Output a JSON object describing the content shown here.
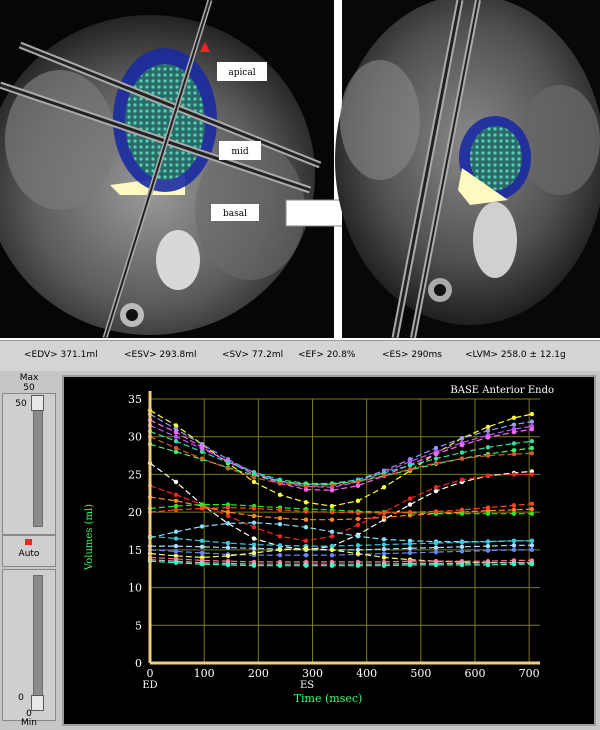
{
  "image_labels": {
    "apical": "apical",
    "mid": "mid",
    "basal": "basal"
  },
  "status": {
    "edv": "<EDV> 371.1ml",
    "esv": "<ESV> 293.8ml",
    "sv": "<SV> 77.2ml",
    "ef": "<EF> 20.8%",
    "es": "<ES> 290ms",
    "lvm": "<LVM> 258.0 ± 12.1g"
  },
  "controls": {
    "max_label": "Max",
    "max_value": "50",
    "slider_top_value": "50",
    "auto_label": "Auto",
    "slider_bottom_value": "0",
    "min_value": "0",
    "min_label": "Min"
  },
  "colors": {
    "axis": "#f0d080",
    "grid": "#7a7a14",
    "tick_text": "#ffffff",
    "title_text": "#ffffff",
    "label_text": "#33ff66"
  },
  "chart_data": {
    "type": "line",
    "title": "BASE  Anterior  Endo",
    "xlabel": "Time (msec)",
    "ylabel": "Volumes (ml)",
    "xlim": [
      0,
      720
    ],
    "ylim": [
      0,
      35
    ],
    "x_ticks": [
      "0",
      "100",
      "200",
      "300",
      "400",
      "500",
      "600",
      "700"
    ],
    "y_ticks": [
      "0",
      "5",
      "10",
      "15",
      "20",
      "25",
      "30",
      "35"
    ],
    "x_markers": [
      {
        "x": 0,
        "label": "ED"
      },
      {
        "x": 290,
        "label": "ES"
      }
    ],
    "grid": true,
    "x": [
      0,
      48,
      96,
      144,
      192,
      240,
      288,
      336,
      384,
      432,
      480,
      528,
      576,
      624,
      672,
      705
    ],
    "series": [
      {
        "color": "#ffff33",
        "values": [
          33.5,
          31.5,
          29.0,
          26.5,
          24.0,
          22.3,
          21.3,
          20.8,
          21.5,
          23.3,
          25.5,
          27.8,
          29.8,
          31.3,
          32.5,
          33.0
        ]
      },
      {
        "color": "#9999ff",
        "values": [
          33.0,
          31.0,
          29.0,
          27.0,
          25.2,
          24.0,
          23.6,
          23.7,
          24.3,
          25.5,
          27.0,
          28.5,
          29.8,
          30.8,
          31.6,
          32.0
        ]
      },
      {
        "color": "#bb55ff",
        "values": [
          31.5,
          30.0,
          28.4,
          26.8,
          25.3,
          24.1,
          23.4,
          23.3,
          24.0,
          25.3,
          26.7,
          28.0,
          29.2,
          30.2,
          31.0,
          31.4
        ]
      },
      {
        "color": "#ff66ff",
        "values": [
          32.2,
          30.6,
          28.6,
          26.7,
          25.0,
          23.8,
          23.0,
          22.9,
          23.5,
          24.8,
          26.3,
          27.7,
          28.9,
          29.9,
          30.6,
          31.0
        ]
      },
      {
        "color": "#33ddaa",
        "values": [
          30.7,
          29.4,
          28.0,
          26.6,
          25.3,
          24.3,
          23.8,
          23.8,
          24.3,
          25.2,
          26.2,
          27.1,
          27.9,
          28.6,
          29.1,
          29.4
        ]
      },
      {
        "color": "#33ff66",
        "values": [
          29.0,
          28.0,
          27.0,
          25.9,
          24.9,
          24.1,
          23.7,
          23.7,
          24.1,
          24.8,
          25.6,
          26.4,
          27.1,
          27.7,
          28.2,
          28.5
        ]
      },
      {
        "color": "#dd5533",
        "values": [
          30.0,
          28.5,
          27.1,
          25.8,
          24.6,
          23.8,
          23.4,
          23.5,
          24.0,
          24.8,
          25.7,
          26.5,
          27.1,
          27.5,
          27.7,
          27.8
        ]
      },
      {
        "color": "#ffffff",
        "values": [
          26.5,
          24.0,
          21.0,
          18.5,
          16.5,
          15.5,
          15.0,
          15.5,
          17.0,
          19.0,
          21.0,
          22.8,
          24.0,
          24.8,
          25.2,
          25.4
        ]
      },
      {
        "color": "#ff2222",
        "values": [
          23.5,
          22.3,
          21.0,
          19.5,
          18.0,
          16.8,
          16.2,
          16.8,
          18.3,
          20.0,
          21.8,
          23.3,
          24.3,
          24.8,
          25.0,
          25.0
        ]
      },
      {
        "color": "#ff8822",
        "values": [
          22.0,
          21.5,
          20.8,
          20.0,
          19.5,
          19.2,
          19.0,
          19.0,
          19.1,
          19.3,
          19.6,
          19.8,
          20.0,
          20.2,
          20.3,
          20.4
        ]
      },
      {
        "color": "#22ee22",
        "values": [
          20.5,
          20.8,
          21.0,
          21.0,
          20.8,
          20.6,
          20.4,
          20.3,
          20.1,
          20.0,
          19.9,
          19.8,
          19.8,
          19.8,
          19.8,
          19.8
        ]
      },
      {
        "color": "#ff4422",
        "values": [
          20.0,
          20.3,
          20.5,
          20.6,
          20.5,
          20.3,
          20.1,
          20.0,
          19.9,
          19.9,
          20.0,
          20.1,
          20.3,
          20.6,
          20.9,
          21.1
        ]
      },
      {
        "color": "#88ddff",
        "values": [
          16.6,
          17.4,
          18.1,
          18.5,
          18.6,
          18.4,
          18.0,
          17.4,
          16.8,
          16.4,
          16.2,
          16.1,
          16.1,
          16.1,
          16.2,
          16.2
        ]
      },
      {
        "color": "#33ccdd",
        "values": [
          16.8,
          16.5,
          16.2,
          15.9,
          15.7,
          15.6,
          15.5,
          15.5,
          15.6,
          15.7,
          15.8,
          15.9,
          16.0,
          16.1,
          16.2,
          16.2
        ]
      },
      {
        "color": "#aaddff",
        "values": [
          15.5,
          15.5,
          15.4,
          15.3,
          15.2,
          15.1,
          15.0,
          15.0,
          15.0,
          15.1,
          15.2,
          15.3,
          15.4,
          15.5,
          15.6,
          15.6
        ]
      },
      {
        "color": "#6688ff",
        "values": [
          15.0,
          14.8,
          14.6,
          14.4,
          14.3,
          14.3,
          14.3,
          14.3,
          14.4,
          14.5,
          14.6,
          14.7,
          14.8,
          14.9,
          15.0,
          15.0
        ]
      },
      {
        "color": "#ffff66",
        "values": [
          14.5,
          14.2,
          14.0,
          14.2,
          14.6,
          15.0,
          15.2,
          15.0,
          14.5,
          14.0,
          13.7,
          13.5,
          13.4,
          13.3,
          13.3,
          13.3
        ]
      },
      {
        "color": "#ff7799",
        "values": [
          14.0,
          13.8,
          13.6,
          13.5,
          13.4,
          13.4,
          13.4,
          13.4,
          13.4,
          13.4,
          13.5,
          13.5,
          13.5,
          13.5,
          13.6,
          13.6
        ]
      },
      {
        "color": "#bbbbbb",
        "values": [
          13.7,
          13.5,
          13.3,
          13.2,
          13.1,
          13.1,
          13.1,
          13.1,
          13.1,
          13.1,
          13.2,
          13.2,
          13.2,
          13.3,
          13.3,
          13.3
        ]
      },
      {
        "color": "#33ffcc",
        "values": [
          13.5,
          13.3,
          13.1,
          13.0,
          12.9,
          12.9,
          12.9,
          12.9,
          12.9,
          12.9,
          13.0,
          13.0,
          13.0,
          13.0,
          13.1,
          13.1
        ]
      }
    ]
  }
}
